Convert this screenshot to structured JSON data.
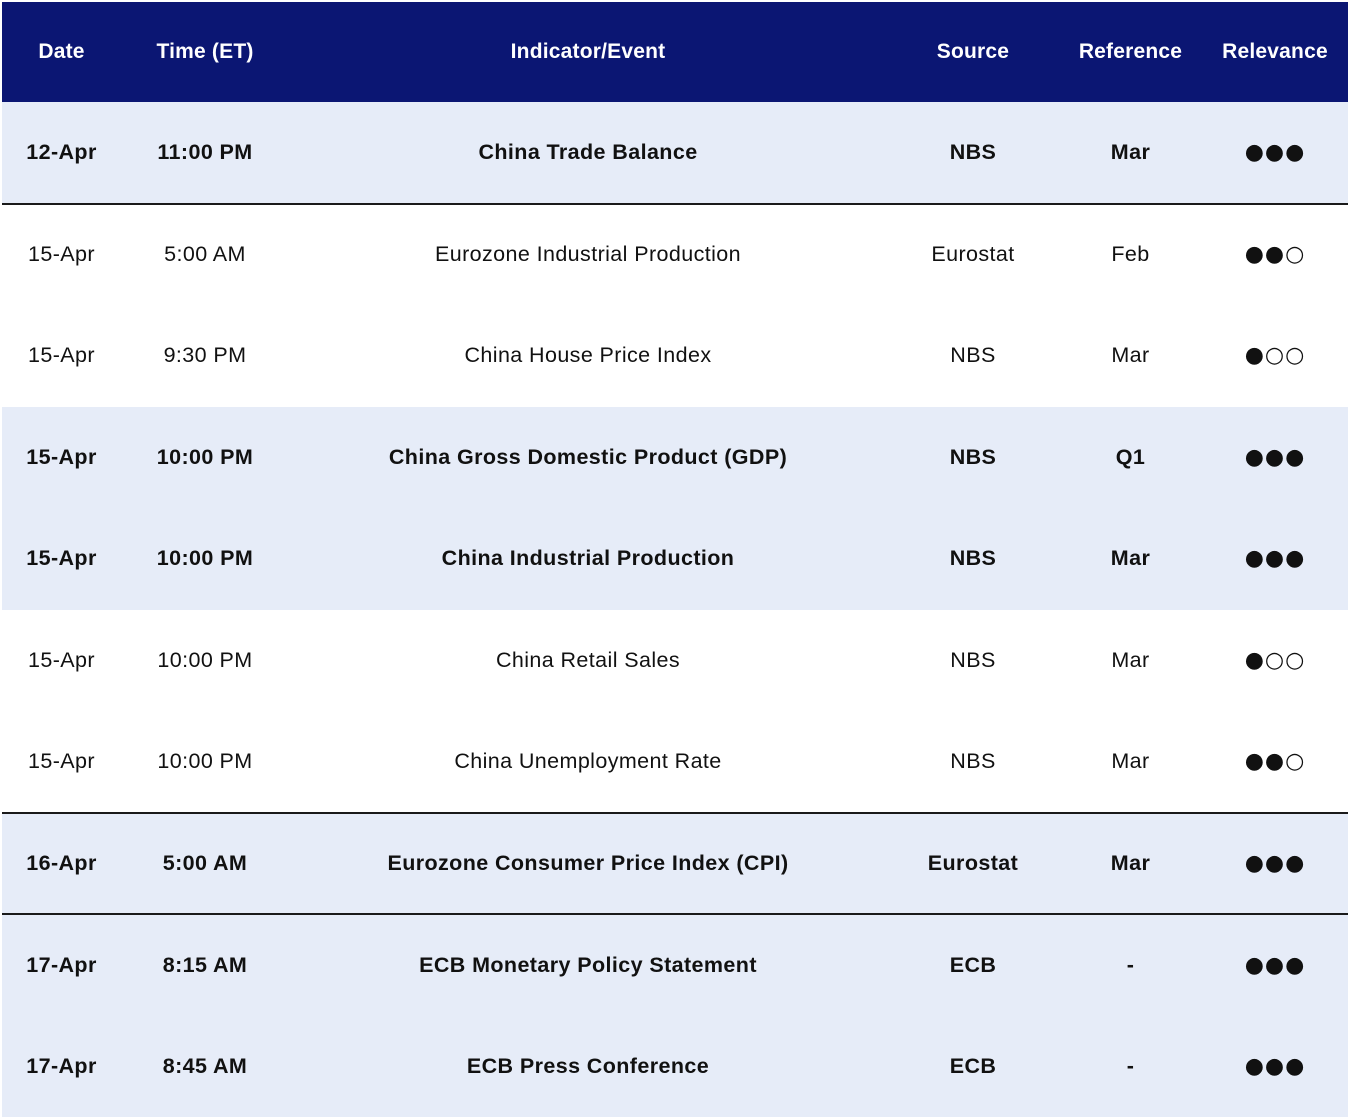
{
  "headers": {
    "date": "Date",
    "time": "Time (ET)",
    "indicator": "Indicator/Event",
    "source": "Source",
    "reference": "Reference",
    "relevance": "Relevance"
  },
  "rows": [
    {
      "date": "12-Apr",
      "time": "11:00 PM",
      "indicator": "China Trade Balance",
      "source": "NBS",
      "reference": "Mar",
      "relevance": "●●●"
    },
    {
      "date": "15-Apr",
      "time": "5:00 AM",
      "indicator": "Eurozone Industrial Production",
      "source": "Eurostat",
      "reference": "Feb",
      "relevance": "●●○"
    },
    {
      "date": "15-Apr",
      "time": "9:30 PM",
      "indicator": "China House Price Index",
      "source": "NBS",
      "reference": "Mar",
      "relevance": "●○○"
    },
    {
      "date": "15-Apr",
      "time": "10:00 PM",
      "indicator": "China Gross Domestic Product (GDP)",
      "source": "NBS",
      "reference": "Q1",
      "relevance": "●●●"
    },
    {
      "date": "15-Apr",
      "time": "10:00 PM",
      "indicator": "China Industrial Production",
      "source": "NBS",
      "reference": "Mar",
      "relevance": "●●●"
    },
    {
      "date": "15-Apr",
      "time": "10:00 PM",
      "indicator": "China Retail Sales",
      "source": "NBS",
      "reference": "Mar",
      "relevance": "●○○"
    },
    {
      "date": "15-Apr",
      "time": "10:00 PM",
      "indicator": "China Unemployment Rate",
      "source": "NBS",
      "reference": "Mar",
      "relevance": "●●○"
    },
    {
      "date": "16-Apr",
      "time": "5:00 AM",
      "indicator": "Eurozone Consumer Price Index (CPI)",
      "source": "Eurostat",
      "reference": "Mar",
      "relevance": "●●●"
    },
    {
      "date": "17-Apr",
      "time": "8:15 AM",
      "indicator": "ECB Monetary Policy Statement",
      "source": "ECB",
      "reference": "-",
      "relevance": "●●●"
    },
    {
      "date": "17-Apr",
      "time": "8:45 AM",
      "indicator": "ECB Press Conference",
      "source": "ECB",
      "reference": "-",
      "relevance": "●●●"
    }
  ],
  "colors": {
    "header_background": "#0b1673",
    "header_text": "#ffffff",
    "shaded_row": "#e6ecf8",
    "divider": "#1a1a1a"
  }
}
